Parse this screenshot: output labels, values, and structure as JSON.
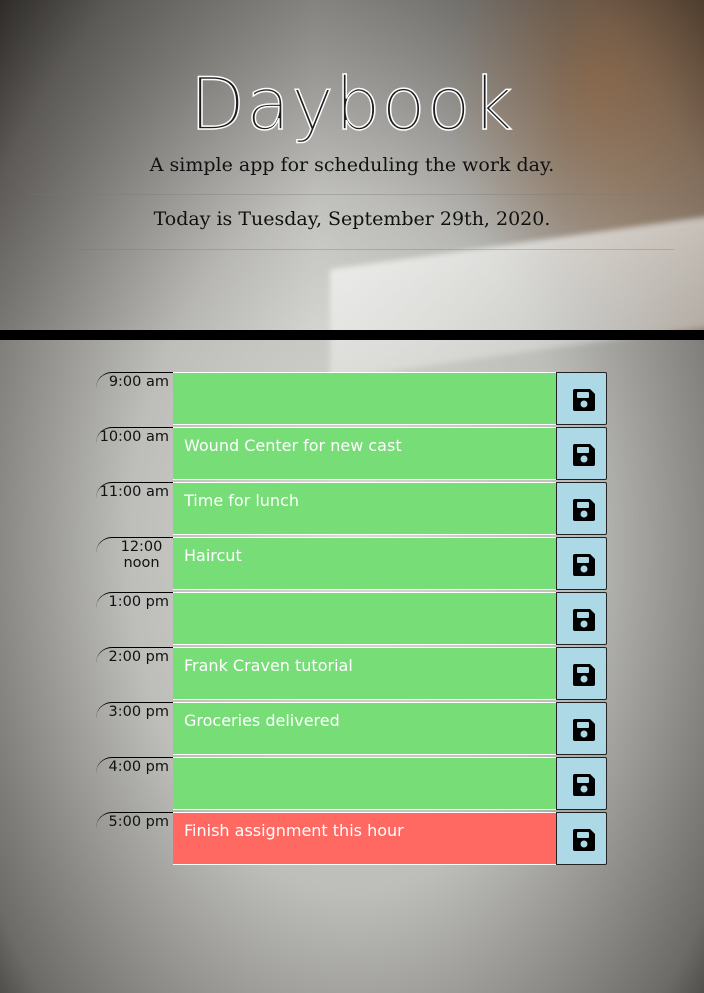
{
  "header": {
    "title": "Daybook",
    "subtitle": "A simple app for scheduling the work day.",
    "date_text": "Today is Tuesday, September 29th, 2020."
  },
  "colors": {
    "future": "#77dd77",
    "present": "#ff6961",
    "save_button": "#add8e6"
  },
  "save_icon": "floppy-disk-icon",
  "rows": [
    {
      "hour": "9:00 am",
      "task": "",
      "state": "future"
    },
    {
      "hour": "10:00 am",
      "task": "Wound Center for new cast",
      "state": "future"
    },
    {
      "hour": "11:00 am",
      "task": "Time for lunch",
      "state": "future"
    },
    {
      "hour_line1": "12:00",
      "hour_line2": "noon",
      "task": "Haircut",
      "state": "future"
    },
    {
      "hour": "1:00 pm",
      "task": "",
      "state": "future"
    },
    {
      "hour": "2:00 pm",
      "task": "Frank Craven tutorial",
      "state": "future"
    },
    {
      "hour": "3:00 pm",
      "task": "Groceries delivered",
      "state": "future"
    },
    {
      "hour": "4:00 pm",
      "task": "",
      "state": "future"
    },
    {
      "hour": "5:00 pm",
      "task": "Finish assignment this hour",
      "state": "present"
    }
  ]
}
